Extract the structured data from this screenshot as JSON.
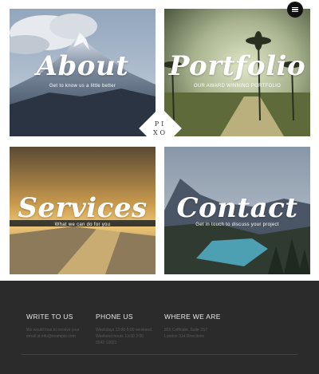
{
  "tiles": {
    "about": {
      "title": "About",
      "subtitle": "Get to know us a little better"
    },
    "portfolio": {
      "title": "Portfolio",
      "subtitle": "OUR AWARD WINNING PORTFOLIO"
    },
    "services": {
      "title": "Services",
      "subtitle": "What we can do for you"
    },
    "contact": {
      "title": "Contact",
      "subtitle": "Get in touch to discuss your project"
    }
  },
  "logo": {
    "line1": "PI",
    "line2": "XO"
  },
  "menu": {
    "icon": "hamburger-icon"
  },
  "footer": {
    "write": {
      "heading": "WRITE TO US",
      "text": "We would love to receive your email at info@example.com"
    },
    "phone": {
      "heading": "PHONE US",
      "text": "Weekdays 12:00-5:00 weekend Weekend hours 13:00 2:00 0542 13021"
    },
    "where": {
      "heading": "WHERE WE ARE",
      "text": "855 Coffinder, Suite 2ST London 314 Directions"
    }
  },
  "colors": {
    "footer_bg": "#2b2b2b",
    "footer_heading": "#e8e8e8",
    "footer_text": "#5a5a5a"
  }
}
